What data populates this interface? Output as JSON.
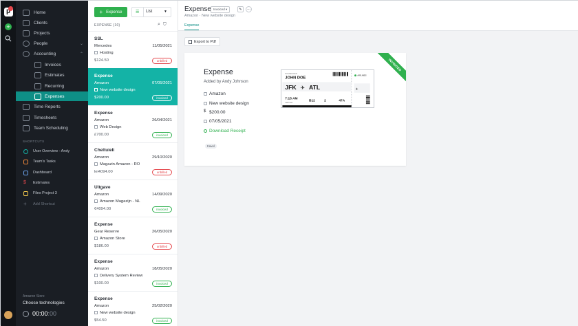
{
  "rail": {
    "add_label": "+",
    "icons": [
      "logo",
      "add-icon",
      "search-icon",
      "avatar"
    ]
  },
  "sidebar": {
    "items": [
      {
        "label": "Home",
        "icon": "home-icon"
      },
      {
        "label": "Clients",
        "icon": "clients-icon"
      },
      {
        "label": "Projects",
        "icon": "folder-icon"
      },
      {
        "label": "People",
        "icon": "people-icon"
      },
      {
        "label": "Accounting",
        "icon": "dollar-icon"
      },
      {
        "label": "Invoices",
        "icon": "invoice-icon"
      },
      {
        "label": "Estimates",
        "icon": "estimate-icon"
      },
      {
        "label": "Recurring",
        "icon": "recurring-icon"
      },
      {
        "label": "Expenses",
        "icon": "expense-icon"
      },
      {
        "label": "Time Reports",
        "icon": "time-reports-icon"
      },
      {
        "label": "Timesheets",
        "icon": "timesheet-icon"
      },
      {
        "label": "Team Scheduling",
        "icon": "schedule-icon"
      }
    ],
    "shortcuts_title": "SHORTCUTS",
    "shortcuts": [
      {
        "label": "User Overview - Andy",
        "color": "#14b3a6"
      },
      {
        "label": "Team's Tasks",
        "color": "#e8843a"
      },
      {
        "label": "Dashboard",
        "color": "#6aa0e8"
      },
      {
        "label": "Estimates",
        "color": "#e5484d"
      },
      {
        "label": "Files Project 3",
        "color": "#f2c94c"
      },
      {
        "label": "Add Shortcut",
        "color": "#6f7782"
      }
    ],
    "bottom_small": "Amazon Store",
    "bottom_main": "Choose technologies",
    "timer_main": "00:00",
    "timer_dim": ":00"
  },
  "list": {
    "add_button": "Expense",
    "view_label": "List",
    "header": "EXPENSE (10)",
    "rows": [
      {
        "title": "SSL",
        "vendor": "Mercedes",
        "date": "11/05/2021",
        "project": "Hosting",
        "amount": "$124.50",
        "status": "unbilled"
      },
      {
        "title": "Expense",
        "vendor": "Amazon",
        "date": "07/05/2021",
        "project": "New website design",
        "amount": "$200.00",
        "status": "invoiced"
      },
      {
        "title": "Expense",
        "vendor": "Amazon",
        "date": "26/04/2021",
        "project": "Web Design",
        "amount": "£700.00",
        "status": "invoiced"
      },
      {
        "title": "Cheltuieli",
        "vendor": "Amazon",
        "date": "29/10/2020",
        "project": "Magazin Amazon - RO",
        "amount": "lei4094.00",
        "status": "unbilled"
      },
      {
        "title": "Uitgave",
        "vendor": "Amazon",
        "date": "14/09/2020",
        "project": "Amazon Magazijn - NL",
        "amount": "€4094.00",
        "status": "invoiced"
      },
      {
        "title": "Expense",
        "vendor": "Gear Reserve",
        "date": "26/05/2020",
        "project": "Amazon Store",
        "amount": "$186.00",
        "status": "unbilled"
      },
      {
        "title": "Expense",
        "vendor": "Amazon",
        "date": "18/05/2020",
        "project": "Delivery System Review",
        "amount": "$100.00",
        "status": "invoiced"
      },
      {
        "title": "Expense",
        "vendor": "Amazon",
        "date": "25/02/2020",
        "project": "New website design",
        "amount": "$54.50",
        "status": "invoiced"
      }
    ]
  },
  "main": {
    "title": "Expense",
    "badge": "Invoiced ▾",
    "subtitle": "Amazon · New website design",
    "tab": "Expense",
    "export_label": "Export to Pdf",
    "card": {
      "title": "Expense",
      "added_by": "Added by Andy Johnson",
      "vendor": "Amazon",
      "project": "New website design",
      "amount": "$200.00",
      "date": "07/05/2021",
      "download": "Download Receipt",
      "tag": "travel",
      "ribbon": "INVOICED"
    },
    "ticket": {
      "airline": "AIRLINES",
      "passenger_label": "PASSENGER",
      "passenger": "JOHN DOE",
      "from": "JFK",
      "to": "ATL",
      "time": "7:15 AM",
      "date": "JULY 16",
      "gate": "B12",
      "terminal": "2",
      "seat": "47A"
    }
  }
}
